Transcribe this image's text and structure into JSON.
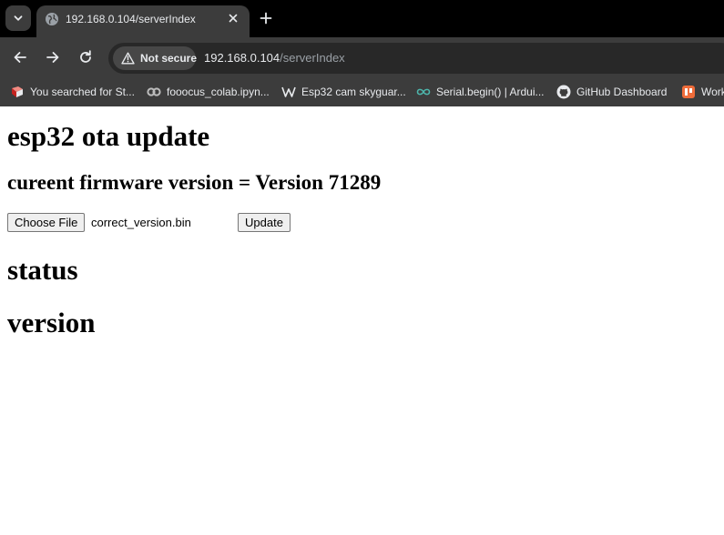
{
  "browser": {
    "tab": {
      "title": "192.168.0.104/serverIndex",
      "favicon": "globe-icon"
    },
    "security_label": "Not secure",
    "url_host": "192.168.0.104",
    "url_path": "/serverIndex",
    "bookmarks": [
      {
        "label": "You searched for St...",
        "icon": "red-book-icon"
      },
      {
        "label": "fooocus_colab.ipyn...",
        "icon": "colab-icon"
      },
      {
        "label": "Esp32 cam skyguar...",
        "icon": "wikipedia-icon"
      },
      {
        "label": "Serial.begin() | Ardui...",
        "icon": "arduino-icon"
      },
      {
        "label": "GitHub Dashboard",
        "icon": "github-icon"
      },
      {
        "label": "Work",
        "icon": "orange-app-icon"
      }
    ]
  },
  "page": {
    "title": "esp32 ota update",
    "firmware_line": "cureent firmware version = Version 71289",
    "choose_file_label": "Choose File",
    "selected_file": "correct_version.bin",
    "update_label": "Update",
    "status_heading": "status",
    "version_heading": "version"
  },
  "colors": {
    "tab_strip": "#000000",
    "toolbar": "#3c3c3c",
    "omnibox": "#282828",
    "text_light": "#e8eaed",
    "url_path": "#9aa0a6",
    "page_background": "#ffffff"
  }
}
